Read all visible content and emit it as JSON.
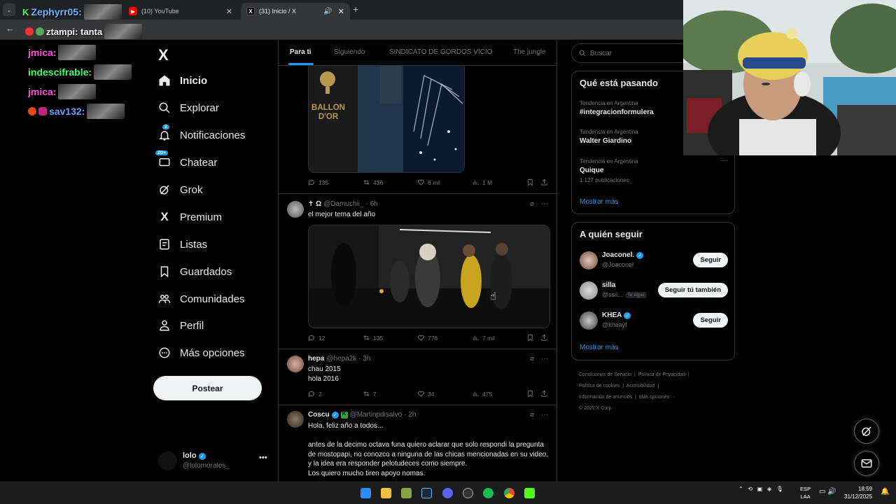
{
  "browser": {
    "tabs": [
      {
        "title": "(10) YouTube",
        "favicon": "youtube-icon"
      },
      {
        "title": "(31) Inicio / X",
        "favicon": "x-icon",
        "active": true
      }
    ],
    "new_tab": "+",
    "close": "✕"
  },
  "overlay_chat": {
    "top_user": "Zephyrr05:",
    "addr_line": "ztampi: tanta",
    "lines": [
      {
        "user": "jmica:",
        "color": "#ff4fd8"
      },
      {
        "user": "indescifrable:",
        "color": "#3dff6a"
      },
      {
        "user": "jmica:",
        "color": "#ff4fd8"
      },
      {
        "user": "sav132:",
        "color": "#6f9bff"
      }
    ]
  },
  "nav": {
    "logo": "X",
    "items": [
      {
        "label": "Inicio",
        "icon": "home-icon"
      },
      {
        "label": "Explorar",
        "icon": "search-icon"
      },
      {
        "label": "Notificaciones",
        "icon": "bell-icon",
        "badge": "2"
      },
      {
        "label": "Chatear",
        "icon": "chat-icon",
        "badge": "20+"
      },
      {
        "label": "Grok",
        "icon": "grok-icon"
      },
      {
        "label": "Premium",
        "icon": "x-icon"
      },
      {
        "label": "Listas",
        "icon": "list-icon"
      },
      {
        "label": "Guardados",
        "icon": "bookmark-icon"
      },
      {
        "label": "Comunidades",
        "icon": "communities-icon"
      },
      {
        "label": "Perfil",
        "icon": "person-icon"
      },
      {
        "label": "Más opciones",
        "icon": "more-circle-icon"
      }
    ],
    "post_button": "Postear",
    "profile": {
      "name": "lolo",
      "handle": "@lolomorales_",
      "more": "•••"
    }
  },
  "timeline": {
    "tabs": [
      "Para ti",
      "Siguiendo",
      "SINDICATO DE GORDOS VICIO",
      "The jungle"
    ],
    "tweets": [
      {
        "media_text": "BALLON\nD'OR",
        "stats": {
          "replies": "135",
          "retweets": "436",
          "likes": "6 mil",
          "views": "1 M"
        }
      },
      {
        "name": "✝ Ω",
        "handle": "@Damuchii_",
        "time": "· 6h",
        "text": "el mejor tema del año",
        "stats": {
          "replies": "12",
          "retweets": "135",
          "likes": "776",
          "views": "7 mil"
        }
      },
      {
        "name": "hepa",
        "handle": "@hepa2k",
        "time": "· 3h",
        "text": "chau 2015\nhola 2016",
        "stats": {
          "replies": "2",
          "retweets": "7",
          "likes": "34",
          "views": "475"
        }
      },
      {
        "name": "Coscu",
        "handle": "@Martinpdisalvo",
        "time": "· 2h",
        "text": "Hola, feliz año a todos...\n\nantes de la decimo octava funa quiero aclarar que solo respondi la pregunta de mostopapi, no conozco a ninguna de las chicas mencionadas en su video, y la idea era responder pelotudeces como siempre.\nLos quiero mucho tiren apoyo nomas."
      }
    ]
  },
  "right": {
    "search_placeholder": "Buscar",
    "trends_title": "Qué está pasando",
    "trends": [
      {
        "context": "Tendencia en Argentina",
        "topic": "#integracionformulera"
      },
      {
        "context": "Tendencia en Argentina",
        "topic": "Walter Giardino"
      },
      {
        "context": "Tendencia en Argentina",
        "topic": "Quique",
        "count": "1.127 publicaciones"
      }
    ],
    "show_more": "Mostrar más",
    "follow_title": "A quién seguir",
    "follow": [
      {
        "name": "Joaconel.",
        "handle": "@Joaconel",
        "button": "Seguir",
        "verified": true
      },
      {
        "name": "silla",
        "handle": "@ssil...",
        "tag": "Te sigue",
        "button": "Seguir tú también"
      },
      {
        "name": "KHEA",
        "handle": "@kheayf",
        "button": "Seguir",
        "verified": true
      }
    ],
    "footer": [
      "Condiciones de Servicio",
      "Política de Privacidad",
      "Política de cookies",
      "Accesibilidad",
      "Información de anuncios",
      "Más opciones ···",
      "© 2025 X Corp."
    ]
  },
  "taskbar": {
    "lang": "ESP\nLAA",
    "time": "18:59",
    "date": "31/12/2025"
  },
  "colors": {
    "accent": "#1d9bf0",
    "bg": "#000000",
    "border": "#2f3336",
    "muted": "#71767b"
  }
}
